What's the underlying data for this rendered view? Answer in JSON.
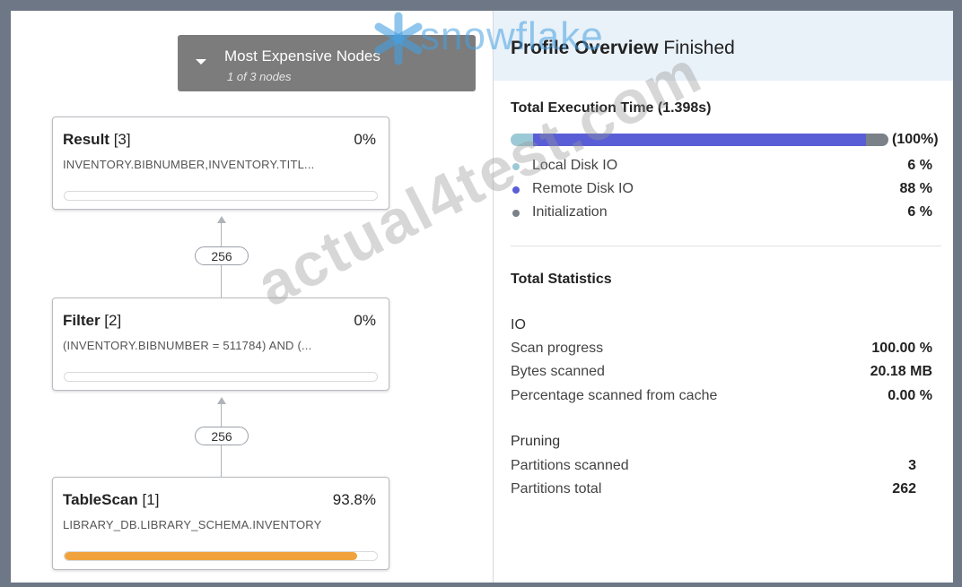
{
  "watermark": {
    "text": "actual4test.com",
    "brand": "snowflake"
  },
  "most_expensive": {
    "title": "Most Expensive Nodes",
    "subtitle": "1 of 3 nodes"
  },
  "nodes": [
    {
      "name": "Result",
      "id": "[3]",
      "percent": "0%",
      "description": "INVENTORY.BIBNUMBER,INVENTORY.TITL...",
      "progress": 0
    },
    {
      "name": "Filter",
      "id": "[2]",
      "percent": "0%",
      "description": "(INVENTORY.BIBNUMBER = 511784) AND (...",
      "progress": 0
    },
    {
      "name": "TableScan",
      "id": "[1]",
      "percent": "93.8%",
      "description": "LIBRARY_DB.LIBRARY_SCHEMA.INVENTORY",
      "progress": 0.938
    }
  ],
  "edges": [
    "256",
    "256"
  ],
  "overview": {
    "title_bold": "Profile Overview",
    "title_status": "Finished",
    "execution": {
      "title": "Total Execution Time (1.398s)",
      "total": "(100%)",
      "breakdown": [
        {
          "label": "Local Disk IO",
          "value": "6 %",
          "fraction": 0.06,
          "color": "#9cc9d6"
        },
        {
          "label": "Remote Disk IO",
          "value": "88 %",
          "fraction": 0.88,
          "color": "#5a5ed6"
        },
        {
          "label": "Initialization",
          "value": "6 %",
          "fraction": 0.06,
          "color": "#7b8189"
        }
      ]
    },
    "statistics": {
      "title": "Total Statistics",
      "io": {
        "title": "IO",
        "rows": [
          {
            "label": "Scan progress",
            "value": "100.00 %"
          },
          {
            "label": "Bytes scanned",
            "value": "20.18 MB"
          },
          {
            "label": "Percentage scanned from cache",
            "value": "0.00 %"
          }
        ]
      },
      "pruning": {
        "title": "Pruning",
        "rows": [
          {
            "label": "Partitions scanned",
            "value": "3"
          },
          {
            "label": "Partitions total",
            "value": "262"
          }
        ]
      }
    }
  }
}
